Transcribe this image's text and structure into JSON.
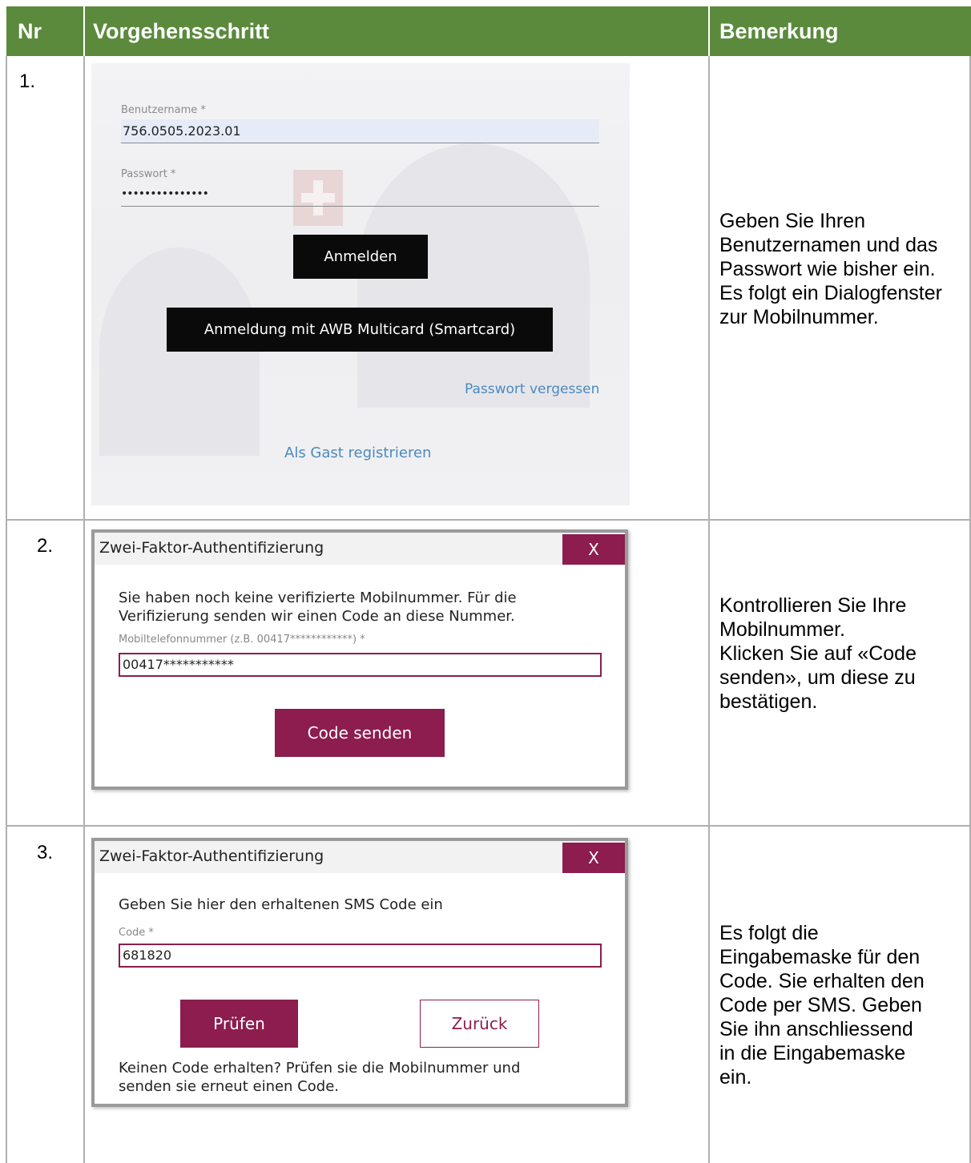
{
  "table": {
    "headers": {
      "nr": "Nr",
      "step": "Vorgehensschritt",
      "remark": "Bemerkung"
    },
    "rows": [
      {
        "nr": "1.",
        "login": {
          "username_label": "Benutzername *",
          "username_value": "756.0505.2023.01",
          "password_label": "Passwort *",
          "password_value": "•••••••••••••••",
          "login_button": "Anmelden",
          "smartcard_button": "Anmeldung mit AWB Multicard (Smartcard)",
          "forgot_link": "Passwort vergessen",
          "guest_link": "Als Gast registrieren"
        },
        "remark": "Geben Sie Ihren Benutzernamen und das Passwort wie bisher ein. Es folgt ein Dialogfenster zur Mobilnummer."
      },
      {
        "nr": "2.",
        "dialog": {
          "title": "Zwei-Faktor-Authentifizierung",
          "close": "X",
          "text_line1": "Sie haben noch keine verifizierte Mobilnummer. Für die",
          "text_line2": "Verifizierung senden wir einen Code an diese Nummer.",
          "field_label": "Mobiltelefonnummer (z.B. 00417************) *",
          "field_value": "00417***********",
          "button": "Code senden"
        },
        "remark_lines": [
          "Kontrollieren Sie Ihre",
          "Mobilnummer.",
          "Klicken Sie auf «Code",
          "senden», um diese zu",
          "bestätigen."
        ]
      },
      {
        "nr": "3.",
        "dialog": {
          "title": "Zwei-Faktor-Authentifizierung",
          "close": "X",
          "text": "Geben Sie hier den erhaltenen SMS Code ein",
          "field_label": "Code *",
          "field_value": "681820",
          "check_button": "Prüfen",
          "back_button": "Zurück",
          "hint_line1": "Keinen Code erhalten? Prüfen sie die Mobilnummer und",
          "hint_line2": "senden sie erneut einen Code."
        },
        "remark_lines": [
          "Es folgt die",
          "Eingabemaske für den",
          "Code. Sie erhalten den",
          "Code per SMS. Geben",
          "Sie ihn anschliessend",
          "in die Eingabemaske",
          "ein."
        ]
      }
    ]
  },
  "colors": {
    "header_bg": "#5b8a3c",
    "accent": "#8c1d4e",
    "link": "#4a8ac0"
  }
}
